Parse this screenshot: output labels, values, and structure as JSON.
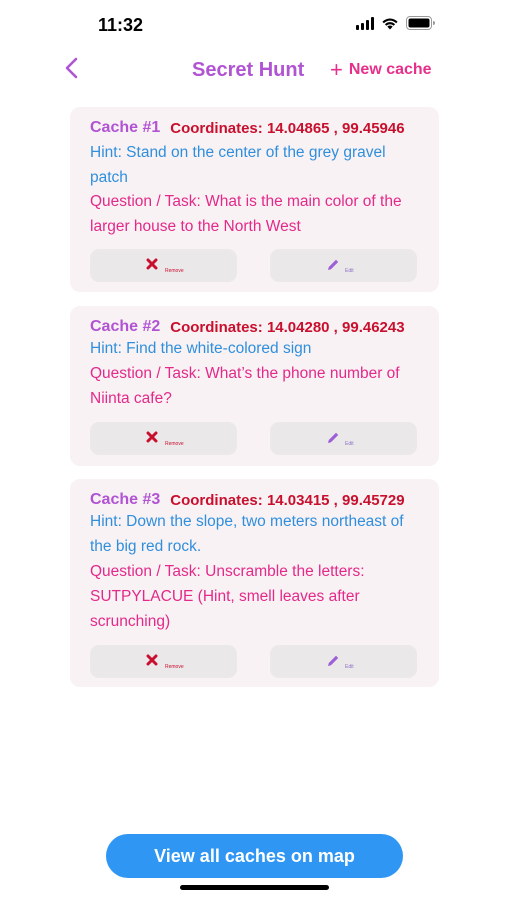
{
  "status": {
    "time": "11:32"
  },
  "nav": {
    "title": "Secret Hunt",
    "new_cache": "New cache"
  },
  "caches": [
    {
      "label": "Cache #1",
      "coords": "Coordinates: 14.04865 , 99.45946",
      "hint": "Hint: Stand on the center of the grey gravel patch",
      "task": "Question / Task: What is the main color of the larger house to the North West",
      "remove": "Remove",
      "edit": "Edit"
    },
    {
      "label": "Cache #2",
      "coords": "Coordinates: 14.04280 , 99.46243",
      "hint": "Hint: Find the white-colored sign",
      "task": "Question / Task: What’s the phone number of Niinta cafe?",
      "remove": "Remove",
      "edit": "Edit"
    },
    {
      "label": "Cache #3",
      "coords": "Coordinates: 14.03415 , 99.45729",
      "hint": "Hint: Down the slope, two meters northeast of the big red rock.",
      "task": "Question / Task: Unscramble the letters: SUTPYLACUE (Hint, smell leaves after scrunching)",
      "remove": "Remove",
      "edit": "Edit"
    }
  ],
  "map_button": "View all caches on map",
  "colors": {
    "title": "#b154d4",
    "new_cache": "#e6308c",
    "coords": "#c8102e",
    "hint": "#2f8fdd",
    "task": "#e3298a",
    "map_button": "#2f97f3"
  }
}
